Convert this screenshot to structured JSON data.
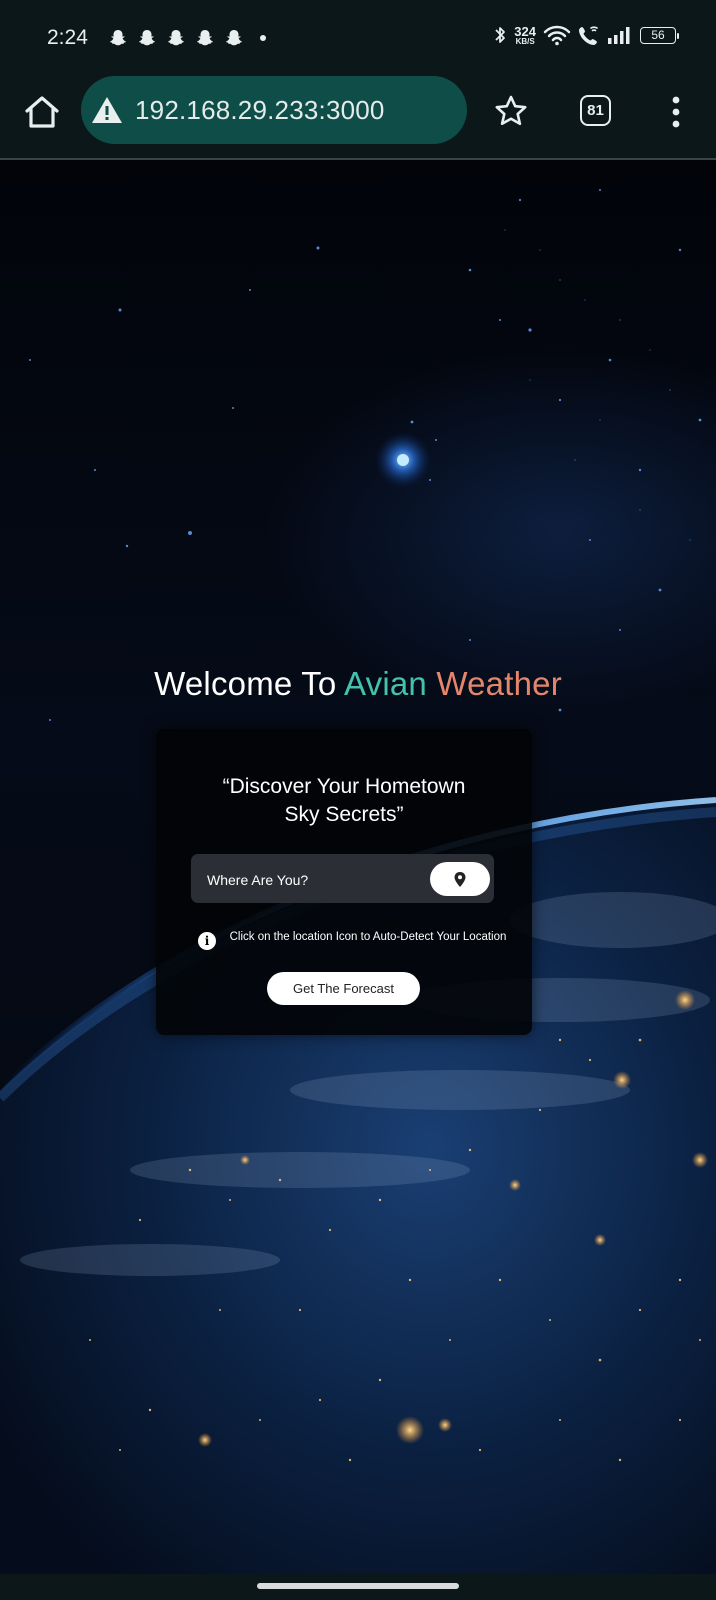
{
  "status_bar": {
    "time": "2:24",
    "notification_icons": [
      "snapchat-icon",
      "snapchat-icon",
      "snapchat-icon",
      "snapchat-icon",
      "snapchat-icon"
    ],
    "net_speed_value": "324",
    "net_speed_unit": "KB/S",
    "battery_level": "56"
  },
  "browser": {
    "url": "192.168.29.233:3000",
    "tab_count": "81",
    "url_bar_color": "#0f4d48"
  },
  "page": {
    "title_prefix": "Welcome To",
    "title_word1": "Avian",
    "title_word2": "Weather",
    "title_word1_color": "#44c2ad",
    "title_word2_color": "#e5866a",
    "tagline_line1": "“Discover Your Hometown",
    "tagline_line2": "Sky Secrets”",
    "search_placeholder": "Where Are You?",
    "info_text": "Click on the location Icon to Auto-Detect Your Location",
    "forecast_button": "Get The Forecast"
  }
}
